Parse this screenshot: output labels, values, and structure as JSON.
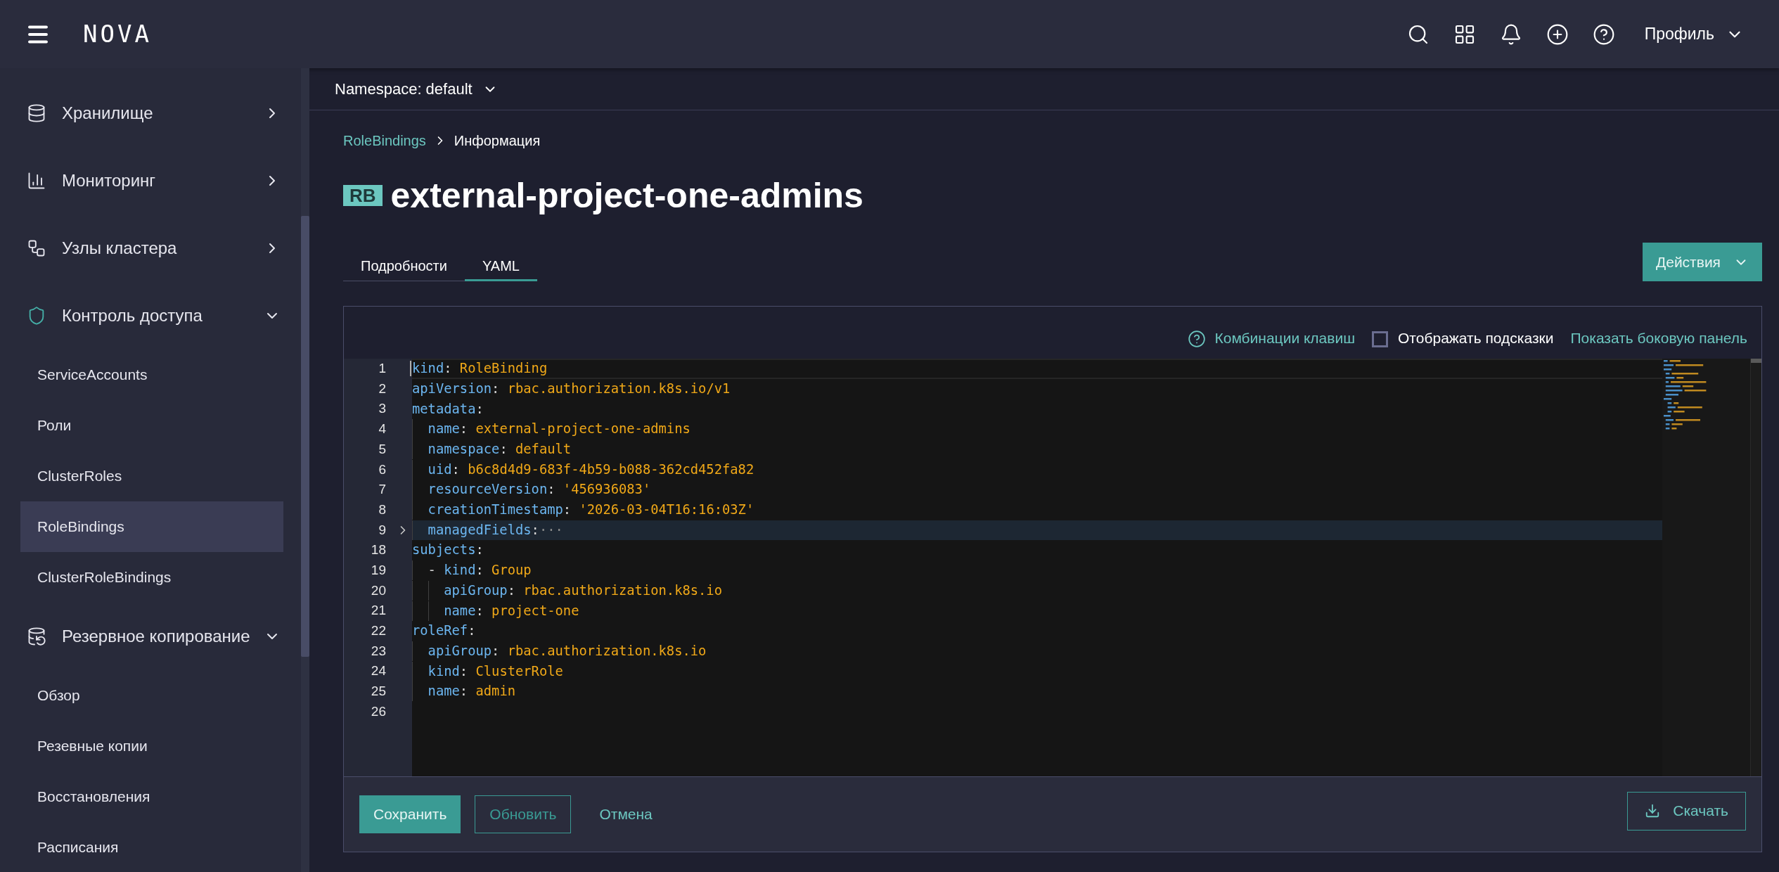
{
  "topbar": {
    "logo": "NOVA",
    "profile": "Профиль"
  },
  "sidebar": {
    "groups": [
      {
        "label": "Хранилище",
        "expanded": false,
        "active": false
      },
      {
        "label": "Мониторинг",
        "expanded": false,
        "active": false
      },
      {
        "label": "Узлы кластера",
        "expanded": false,
        "active": false
      },
      {
        "label": "Контроль доступа",
        "expanded": true,
        "active": true,
        "children": [
          {
            "label": "ServiceAccounts",
            "selected": false
          },
          {
            "label": "Роли",
            "selected": false
          },
          {
            "label": "ClusterRoles",
            "selected": false
          },
          {
            "label": "RoleBindings",
            "selected": true
          },
          {
            "label": "ClusterRoleBindings",
            "selected": false
          }
        ]
      },
      {
        "label": "Резервное копирование",
        "expanded": true,
        "active": false,
        "children": [
          {
            "label": "Обзор",
            "selected": false
          },
          {
            "label": "Резевные копии",
            "selected": false
          },
          {
            "label": "Восстановления",
            "selected": false
          },
          {
            "label": "Расписания",
            "selected": false
          }
        ]
      }
    ]
  },
  "namespace": "Namespace: default",
  "breadcrumb": [
    "RoleBindings",
    "Информация"
  ],
  "title": {
    "badge": "RB",
    "text": "external-project-one-admins"
  },
  "tabs": [
    {
      "label": "Подробности",
      "selected": false
    },
    {
      "label": "YAML",
      "selected": true
    }
  ],
  "actions": "Действия",
  "editor": {
    "shortcuts": "Комбинации клавиш",
    "hints": {
      "label": "Отображать подсказки",
      "checked": false
    },
    "sidebar_link": "Показать боковую панель",
    "lines": [
      {
        "number": "1",
        "key": "kind",
        "sep": ":",
        "value": "RoleBinding",
        "current": true,
        "folded": false
      },
      {
        "number": "2",
        "key": "apiVersion",
        "sep": ":",
        "value": "rbac.authorization.k8s.io/v1",
        "current": false,
        "folded": false
      },
      {
        "number": "3",
        "key": "metadata",
        "sep": ":",
        "current": false,
        "folded": false,
        "children": [
          {
            "number": "4",
            "key": "name",
            "sep": ":",
            "value": "external-project-one-admins",
            "current": false,
            "folded": false
          },
          {
            "number": "5",
            "key": "namespace",
            "sep": ":",
            "value": "default",
            "current": false,
            "folded": false
          },
          {
            "number": "6",
            "key": "uid",
            "sep": ":",
            "value": "b6c8d4d9-683f-4b59-b088-362cd452fa82",
            "current": false,
            "folded": false
          },
          {
            "number": "7",
            "key": "resourceVersion",
            "sep": ":",
            "value": "'456936083'",
            "current": false,
            "folded": false
          },
          {
            "number": "8",
            "key": "creationTimestamp",
            "sep": ":",
            "value": "'2026-03-04T16:16:03Z'",
            "current": false,
            "folded": false
          },
          {
            "number": "9",
            "key": "managedFields",
            "sep": ":",
            "fold_text": "···",
            "current": false,
            "folded": true
          }
        ]
      },
      {
        "number": "18",
        "key": "subjects",
        "sep": ":",
        "current": false,
        "folded": false,
        "children": [
          {
            "number": "19",
            "dash": "-",
            "key": "kind",
            "sep": ":",
            "value": "Group",
            "current": false,
            "folded": false,
            "children": [
              {
                "number": "20",
                "key": "apiGroup",
                "sep": ":",
                "value": "rbac.authorization.k8s.io",
                "current": false,
                "folded": false
              },
              {
                "number": "21",
                "key": "name",
                "sep": ":",
                "value": "project-one",
                "current": false,
                "folded": false
              }
            ]
          }
        ]
      },
      {
        "number": "22",
        "key": "roleRef",
        "sep": ":",
        "current": false,
        "folded": false,
        "children": [
          {
            "number": "23",
            "key": "apiGroup",
            "sep": ":",
            "value": "rbac.authorization.k8s.io",
            "current": false,
            "folded": false
          },
          {
            "number": "24",
            "key": "kind",
            "sep": ":",
            "value": "ClusterRole",
            "current": false,
            "folded": false
          },
          {
            "number": "25",
            "key": "name",
            "sep": ":",
            "value": "admin",
            "current": false,
            "folded": false
          }
        ]
      },
      {
        "number": "26",
        "current": false,
        "folded": false
      }
    ]
  },
  "footer": {
    "buttons": [
      {
        "kind": "primary",
        "label": "Сохранить"
      },
      {
        "kind": "outline",
        "label": "Обновить"
      },
      {
        "kind": "link",
        "label": "Отмена"
      }
    ],
    "download": "Скачать"
  }
}
